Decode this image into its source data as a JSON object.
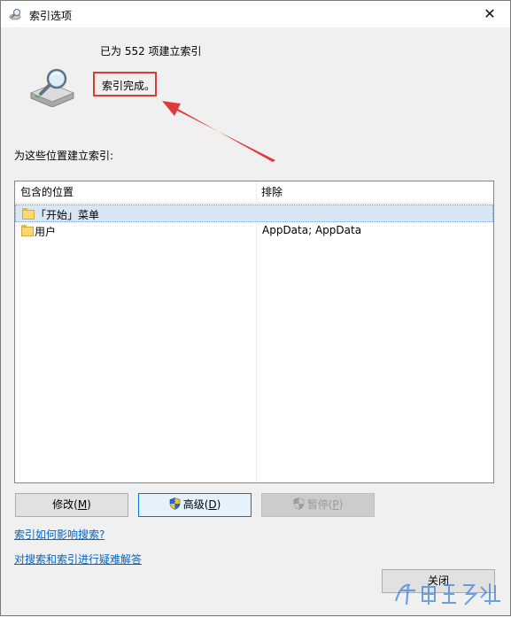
{
  "window": {
    "title": "索引选项",
    "close_glyph": "✕"
  },
  "status": {
    "count_text": "已为 552 项建立索引",
    "state_text": "索引完成。",
    "highlight_color": "#e0393c"
  },
  "locations_label": "为这些位置建立索引:",
  "table": {
    "headers": {
      "included": "包含的位置",
      "exclude": "排除"
    },
    "rows": [
      {
        "location": "「开始」菜单",
        "exclude": "",
        "selected": true
      },
      {
        "location": "用户",
        "exclude": "AppData; AppData",
        "selected": false
      }
    ]
  },
  "buttons": {
    "modify": {
      "label": "修改(",
      "key": "M",
      "suffix": ")"
    },
    "advanced": {
      "label": "高级(",
      "key": "D",
      "suffix": ")"
    },
    "pause": {
      "label": "暂停(",
      "key": "P",
      "suffix": ")"
    },
    "close": "关闭"
  },
  "links": {
    "how_indexing": "索引如何影响搜索?",
    "troubleshoot": "对搜索和索引进行疑难解答"
  },
  "watermark": "​"
}
